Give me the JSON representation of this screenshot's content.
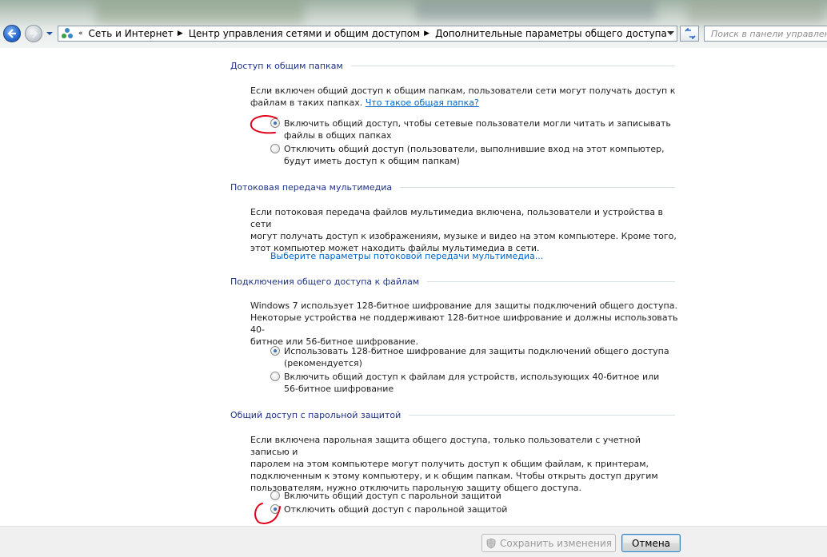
{
  "address_bar": {
    "breadcrumbs": [
      "Сеть и Интернет",
      "Центр управления сетями и общим доступом",
      "Дополнительные параметры общего доступа"
    ],
    "search_placeholder": "Поиск в панели управления"
  },
  "sections": {
    "folders": {
      "title": "Доступ к общим папкам",
      "description_line1": "Если включен общий доступ к общим папкам, пользователи сети могут получать доступ к",
      "description_line2": "файлам в таких папках.",
      "help_link": "Что такое общая папка?",
      "options": [
        {
          "line1": "Включить общий доступ, чтобы сетевые пользователи могли читать и записывать",
          "line2": "файлы в общих папках",
          "checked": true
        },
        {
          "line1": "Отключить общий доступ (пользователи, выполнившие вход на этот компьютер,",
          "line2": "будут иметь доступ к общим папкам)",
          "checked": false
        }
      ]
    },
    "media": {
      "title": "Потоковая передача мультимедиа",
      "description_line1": "Если потоковая передача файлов мультимедиа включена, пользователи и устройства в сети",
      "description_line2": "могут получать доступ к изображениям, музыке и видео на этом компьютере. Кроме того,",
      "description_line3": "этот компьютер может находить файлы мультимедиа в сети.",
      "link": "Выберите параметры потоковой передачи мультимедиа..."
    },
    "file_sharing": {
      "title": "Подключения общего доступа к файлам",
      "description_line1": "Windows 7 использует 128-битное шифрование для защиты подключений общего доступа.",
      "description_line2": "Некоторые устройства не поддерживают 128-битное шифрование и должны использовать 40-",
      "description_line3": "битное или 56-битное шифрование.",
      "options": [
        {
          "line1": "Использовать 128-битное шифрование для защиты подключений общего доступа",
          "line2": "(рекомендуется)",
          "checked": true
        },
        {
          "line1": "Включить общий доступ к файлам для устройств, использующих 40-битное или",
          "line2": "56-битное шифрование",
          "checked": false
        }
      ]
    },
    "password": {
      "title": "Общий доступ с парольной защитой",
      "description_line1": "Если включена парольная защита общего доступа, только пользователи с учетной записью и",
      "description_line2": "паролем на этом компьютере могут получить доступ к общим файлам, к принтерам,",
      "description_line3": "подключенным к этому компьютеру, и к общим папкам. Чтобы открыть доступ другим",
      "description_line4": "пользователям, нужно отключить парольную защиту общего доступа.",
      "options": [
        {
          "line1": "Включить общий доступ с парольной защитой",
          "checked": false
        },
        {
          "line1": "Отключить общий доступ с парольной защитой",
          "checked": true
        }
      ]
    }
  },
  "footer": {
    "save_label": "Сохранить изменения",
    "cancel_label": "Отмена"
  },
  "colors": {
    "section_title": "#1e3287",
    "link": "#0066cc",
    "annotation_mark": "#e0001a"
  }
}
